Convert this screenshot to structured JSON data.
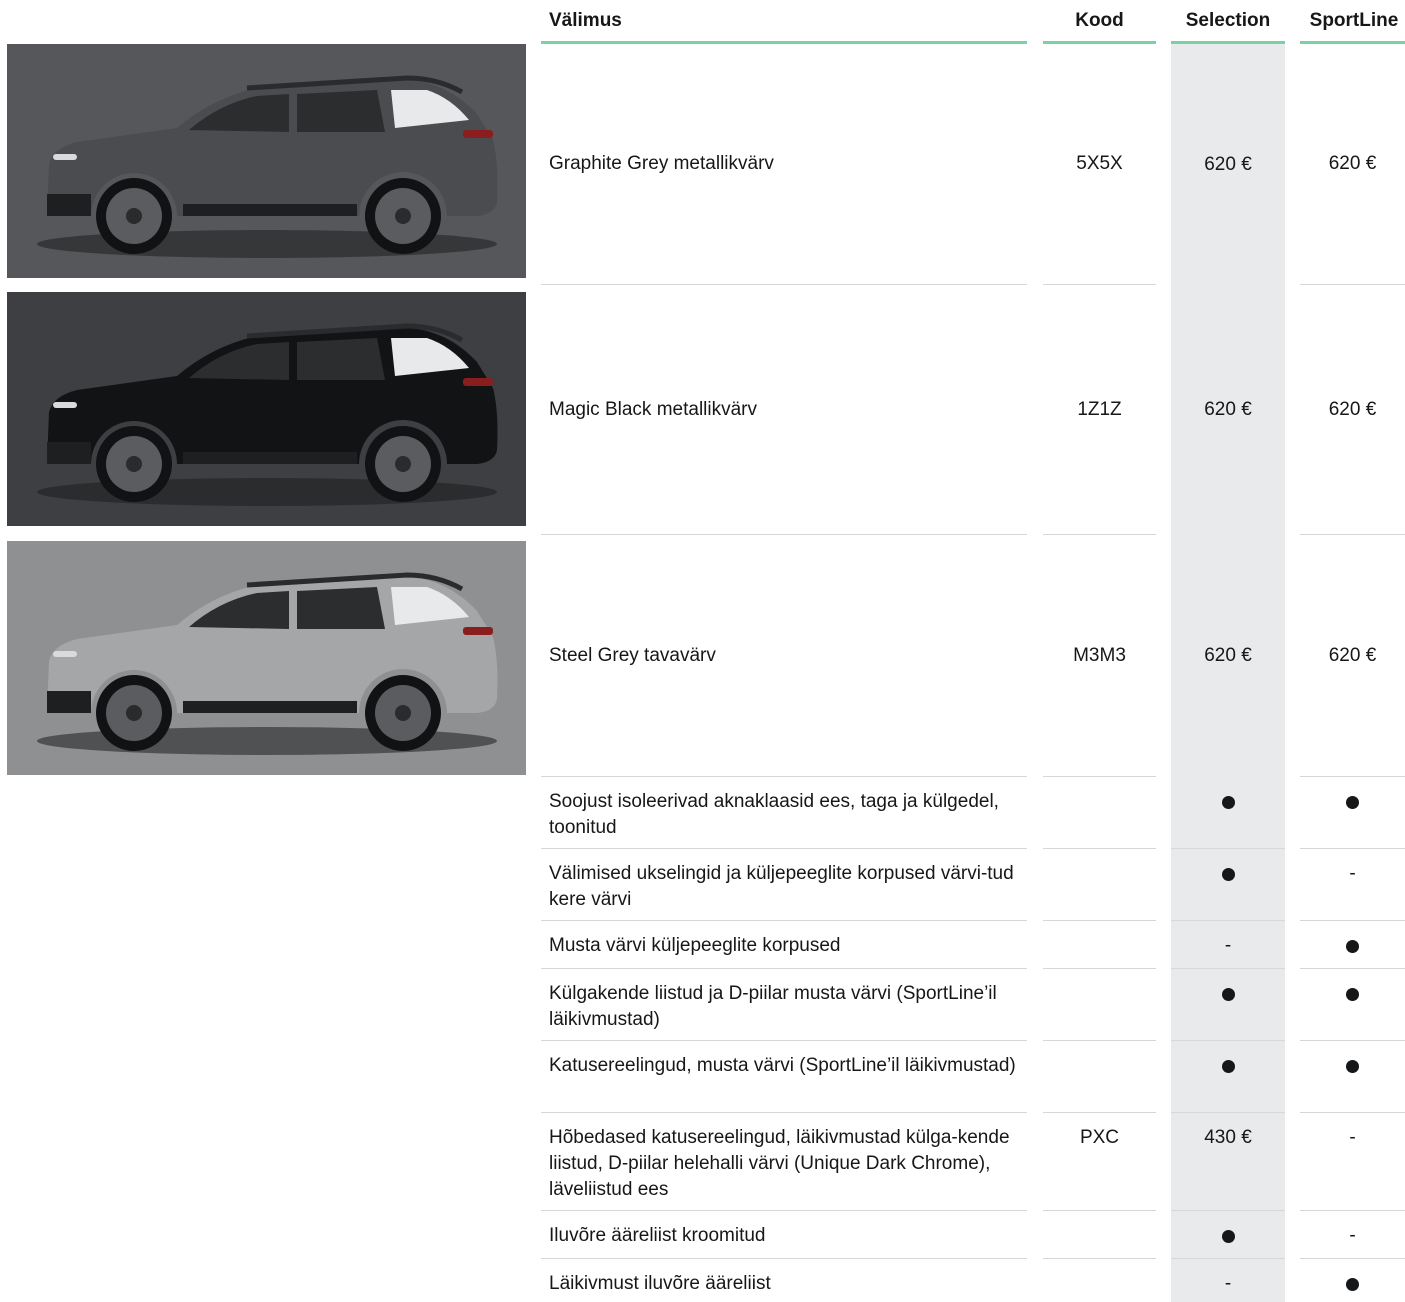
{
  "header": {
    "name": "Välimus",
    "code": "Kood",
    "selection": "Selection",
    "sportline": "SportLine"
  },
  "colors": [
    {
      "name": "Graphite Grey metallikvärv",
      "code": "5X5X",
      "selection": "620 €",
      "sportline": "620 €",
      "body_color": "#4a4c4f",
      "bg_color": "#55575a"
    },
    {
      "name": "Magic Black metallikvärv",
      "code": "1Z1Z",
      "selection": "620 €",
      "sportline": "620 €",
      "body_color": "#121314",
      "bg_color": "#3d3f42"
    },
    {
      "name": "Steel Grey tavavärv",
      "code": "M3M3",
      "selection": "620 €",
      "sportline": "620 €",
      "body_color": "#a4a6a8",
      "bg_color": "#8e9092"
    }
  ],
  "features": [
    {
      "name": "Soojust isoleerivad aknaklaasid ees, taga ja külgedel, toonitud",
      "code": "",
      "selection": "dot",
      "sportline": "dot"
    },
    {
      "name": "Välimised ukselingid ja küljepeeglite korpused värvi-tud kere värvi",
      "code": "",
      "selection": "dot",
      "sportline": "-"
    },
    {
      "name": "Musta värvi küljepeeglite korpused",
      "code": "",
      "selection": "-",
      "sportline": "dot"
    },
    {
      "name": "Külgakende liistud ja D-piilar musta värvi (SportLine’il läikivmustad)",
      "code": "",
      "selection": "dot",
      "sportline": "dot"
    },
    {
      "name": "Katusereelingud, musta värvi (SportLine’il läikivmustad)",
      "code": "",
      "selection": "dot",
      "sportline": "dot"
    },
    {
      "name": "Hõbedased katusereelingud, läikivmustad külga-kende liistud, D-piilar helehalli värvi (Unique Dark Chrome), läveliistud ees",
      "code": "PXC",
      "selection": "430 €",
      "sportline": "-"
    },
    {
      "name": "Iluvõre ääreliist kroomitud",
      "code": "",
      "selection": "dot",
      "sportline": "-"
    },
    {
      "name": "Läikivmust iluvõre ääreliist",
      "code": "",
      "selection": "-",
      "sportline": "dot"
    }
  ]
}
